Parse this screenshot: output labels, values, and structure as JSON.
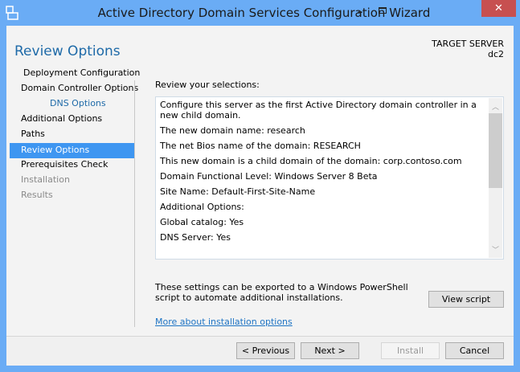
{
  "window": {
    "title": "Active Directory Domain Services Configuration Wizard",
    "minimize": "–",
    "close": "✕"
  },
  "header": {
    "page_title": "Review Options",
    "target_label": "TARGET SERVER",
    "target_name": "dc2"
  },
  "sidebar": {
    "items": [
      {
        "label": "Deployment Configuration",
        "state": "normal"
      },
      {
        "label": "Domain Controller Options",
        "state": "normal"
      },
      {
        "label": "DNS Options",
        "state": "sub"
      },
      {
        "label": "Additional Options",
        "state": "normal"
      },
      {
        "label": "Paths",
        "state": "normal"
      },
      {
        "label": "Review Options",
        "state": "selected"
      },
      {
        "label": "Prerequisites Check",
        "state": "normal"
      },
      {
        "label": "Installation",
        "state": "disabled"
      },
      {
        "label": "Results",
        "state": "disabled"
      }
    ]
  },
  "main": {
    "review_label": "Review your selections:",
    "lines": [
      "Configure this server as the first Active Directory domain controller in a new child domain.",
      "The new domain name: research",
      "The net Bios name of the domain: RESEARCH",
      "This new domain is a child domain of the domain: corp.contoso.com",
      "Domain Functional Level: Windows Server 8 Beta",
      "Site Name: Default-First-Site-Name",
      "Additional Options:",
      "Global catalog: Yes",
      "DNS Server: Yes"
    ],
    "export_text": "These settings can be exported to a Windows PowerShell script to automate additional installations.",
    "view_script": "View script",
    "more_link": "More about installation options"
  },
  "footer": {
    "previous": "< Previous",
    "next": "Next >",
    "install": "Install",
    "cancel": "Cancel"
  }
}
